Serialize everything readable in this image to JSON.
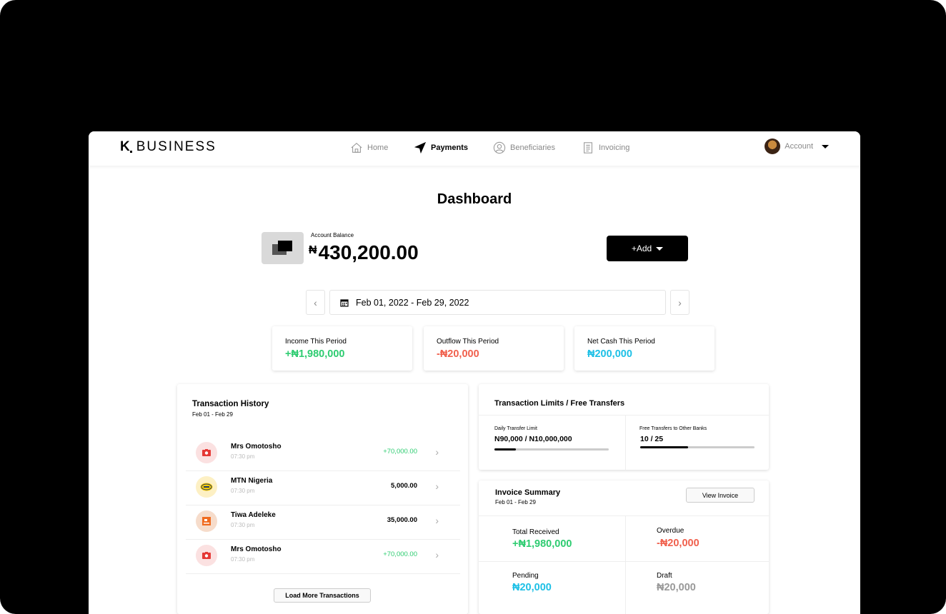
{
  "brand": {
    "mark": "K",
    "name": "BUSINESS"
  },
  "nav": {
    "items": [
      {
        "label": "Home",
        "icon": "home-icon"
      },
      {
        "label": "Payments",
        "icon": "paper-plane-icon",
        "active": true
      },
      {
        "label": "Beneficiaries",
        "icon": "user-circle-icon"
      },
      {
        "label": "Invoicing",
        "icon": "document-icon"
      }
    ],
    "account_label": "Account"
  },
  "page": {
    "title": "Dashboard"
  },
  "balance": {
    "label": "Account Balance",
    "currency": "₦",
    "amount": "430,200.00",
    "add_label": "+Add"
  },
  "date_range": {
    "label": "Feb 01, 2022 - Feb 29, 2022"
  },
  "summary": [
    {
      "label": "Income This Period",
      "value": "+₦1,980,000",
      "color": "#2ecc71"
    },
    {
      "label": "Outflow This Period",
      "value": "-₦20,000",
      "color": "#f0604d"
    },
    {
      "label": "Net Cash This Period",
      "value": "₦200,000",
      "color": "#1ec0e6"
    }
  ],
  "transactions": {
    "title": "Transaction History",
    "subtitle": "Feb 01 - Feb 29",
    "rows": [
      {
        "name": "Mrs Omotosho",
        "time": "07:30 pm",
        "amount": "+70,000.00",
        "type": "credit",
        "icon": "bank-red-icon"
      },
      {
        "name": "MTN Nigeria",
        "time": "07:30 pm",
        "amount": "5,000.00",
        "type": "debit",
        "icon": "mtn-logo-icon"
      },
      {
        "name": "Tiwa Adeleke",
        "time": "07:30 pm",
        "amount": "35,000.00",
        "type": "debit",
        "icon": "bank-orange-icon"
      },
      {
        "name": "Mrs Omotosho",
        "time": "07:30 pm",
        "amount": "+70,000.00",
        "type": "credit",
        "icon": "bank-red-icon"
      }
    ],
    "load_more_label": "Load More Transactions"
  },
  "limits": {
    "title": "Transaction Limits / Free Transfers",
    "daily": {
      "label": "Daily Transfer Limit",
      "value": "N90,000 /  N10,000,000",
      "progress": 0.19
    },
    "free": {
      "label": "Free Transfers to Other Banks",
      "value": "10 /  25",
      "progress": 0.42
    }
  },
  "invoice": {
    "title": "Invoice Summary",
    "subtitle": "Feb 01 - Feb 29",
    "view_label": "View Invoice",
    "cells": [
      {
        "label": "Total Received",
        "value": "+₦1,980,000",
        "color": "#2ecc71"
      },
      {
        "label": "Overdue",
        "value": "-₦20,000",
        "color": "#f0604d"
      },
      {
        "label": "Pending",
        "value": "₦20,000",
        "color": "#1ec0e6"
      },
      {
        "label": "Draft",
        "value": "₦20,000",
        "color": "#999999"
      }
    ]
  }
}
